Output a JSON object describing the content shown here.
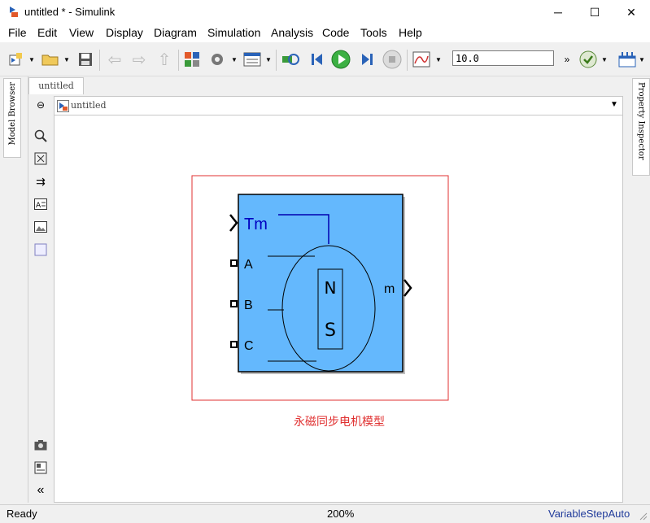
{
  "window": {
    "title": "untitled * - Simulink",
    "minimize": "─",
    "maximize": "☐",
    "close": "✕"
  },
  "menu": [
    "File",
    "Edit",
    "View",
    "Display",
    "Diagram",
    "Simulation",
    "Analysis",
    "Code",
    "Tools",
    "Help"
  ],
  "toolbar": {
    "stop_time": "10.0"
  },
  "side": {
    "model_browser": "Model Browser",
    "property_inspector": "Property Inspector"
  },
  "editor": {
    "tab_label": "untitled",
    "breadcrumb": "untitled",
    "model_caption": "永磁同步电机模型"
  },
  "block": {
    "input_tm": "Tm",
    "input_a": "A",
    "input_b": "B",
    "input_c": "C",
    "output_m": "m",
    "rotor_n": "N",
    "rotor_s": "S",
    "fill_color": "#64b8fd",
    "selection_color": "#e03030"
  },
  "status": {
    "state": "Ready",
    "zoom": "200%",
    "solver": "VariableStepAuto"
  }
}
